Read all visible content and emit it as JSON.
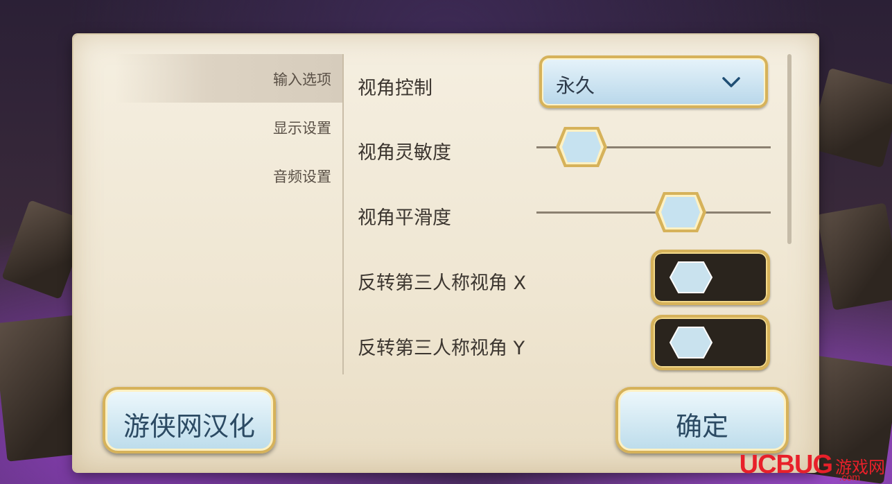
{
  "tabs": [
    {
      "label": "输入选项",
      "active": true
    },
    {
      "label": "显示设置",
      "active": false
    },
    {
      "label": "音频设置",
      "active": false
    }
  ],
  "settings": {
    "camera_control": {
      "label": "视角控制",
      "value": "永久"
    },
    "camera_sensitivity": {
      "label": "视角灵敏度",
      "level": 0.1
    },
    "camera_smoothing": {
      "label": "视角平滑度",
      "level": 0.65
    },
    "invert_x": {
      "label": "反转第三人称视角 X",
      "on": false
    },
    "invert_y": {
      "label": "反转第三人称视角 Y",
      "on": false
    }
  },
  "buttons": {
    "localize": "游侠网汉化",
    "confirm": "确定"
  },
  "watermark": {
    "brand": "UCBUG",
    "cn": "游戏网",
    "domain": ".com"
  },
  "colors": {
    "gold_border": "#d6b25a",
    "button_fill": "#bcdceb",
    "parchment": "#efe6d2"
  }
}
